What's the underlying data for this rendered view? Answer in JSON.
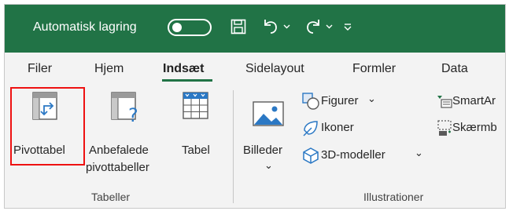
{
  "titlebar": {
    "autosave_label": "Automatisk lagring",
    "icons": [
      "save-icon",
      "undo-icon",
      "redo-icon",
      "customize-qat-icon"
    ]
  },
  "tabs": [
    {
      "label": "Filer",
      "active": false
    },
    {
      "label": "Hjem",
      "active": false
    },
    {
      "label": "Indsæt",
      "active": true
    },
    {
      "label": "Sidelayout",
      "active": false
    },
    {
      "label": "Formler",
      "active": false
    },
    {
      "label": "Data",
      "active": false
    }
  ],
  "ribbon": {
    "tables_group": {
      "label": "Tabeller",
      "pivot_label": "Pivottabel",
      "recommended_line1": "Anbefalede",
      "recommended_line2": "pivottabeller",
      "table_label": "Tabel"
    },
    "illustrations_group": {
      "label": "Illustrationer",
      "pictures_label": "Billeder",
      "shapes_label": "Figurer",
      "icons_label": "Ikoner",
      "models_label": "3D-modeller",
      "smartart_label": "SmartAr",
      "screenshot_label": "Skærmb"
    },
    "chevron": "⌄"
  },
  "colors": {
    "excel_green": "#217346",
    "highlight_red": "#e11111",
    "icon_blue": "#2b78c4"
  }
}
